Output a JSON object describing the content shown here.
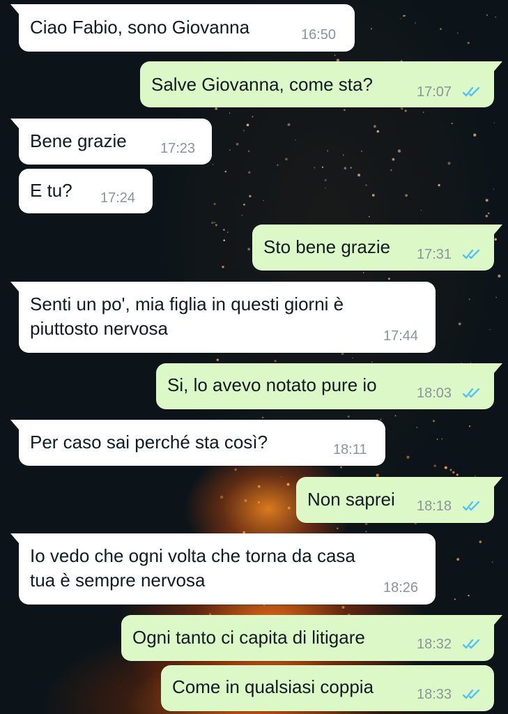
{
  "chat": {
    "tick_color": "#4fc3f7",
    "messages": [
      {
        "from": "contact",
        "lines": [
          "Ciao Fabio, sono Giovanna"
        ],
        "time": "16:50"
      },
      {
        "from": "me",
        "lines": [
          "Salve Giovanna, come sta?"
        ],
        "time": "17:07",
        "status": "read-double-check-icon"
      },
      {
        "from": "contact",
        "lines": [
          "Bene grazie"
        ],
        "time": "17:23"
      },
      {
        "from": "contact",
        "lines": [
          "E tu?"
        ],
        "time": "17:24"
      },
      {
        "from": "me",
        "lines": [
          "Sto bene grazie"
        ],
        "time": "17:31",
        "status": "read-double-check-icon"
      },
      {
        "from": "contact",
        "lines": [
          "Senti un po', mia figlia in questi giorni è",
          "piuttosto nervosa"
        ],
        "time": "17:44"
      },
      {
        "from": "me",
        "lines": [
          "Si, lo avevo notato pure io"
        ],
        "time": "18:03",
        "status": "read-double-check-icon"
      },
      {
        "from": "contact",
        "lines": [
          "Per caso sai perché sta così?"
        ],
        "time": "18:11"
      },
      {
        "from": "me",
        "lines": [
          "Non saprei"
        ],
        "time": "18:18",
        "status": "read-double-check-icon"
      },
      {
        "from": "contact",
        "lines": [
          "Io vedo che ogni volta che torna da casa",
          "tua è sempre nervosa"
        ],
        "time": "18:26"
      },
      {
        "from": "me",
        "lines": [
          "Ogni tanto ci capita di litigare"
        ],
        "time": "18:32",
        "status": "read-double-check-icon"
      },
      {
        "from": "me",
        "lines": [
          "Come in qualsiasi coppia"
        ],
        "time": "18:33",
        "status": "read-double-check-icon"
      }
    ]
  }
}
